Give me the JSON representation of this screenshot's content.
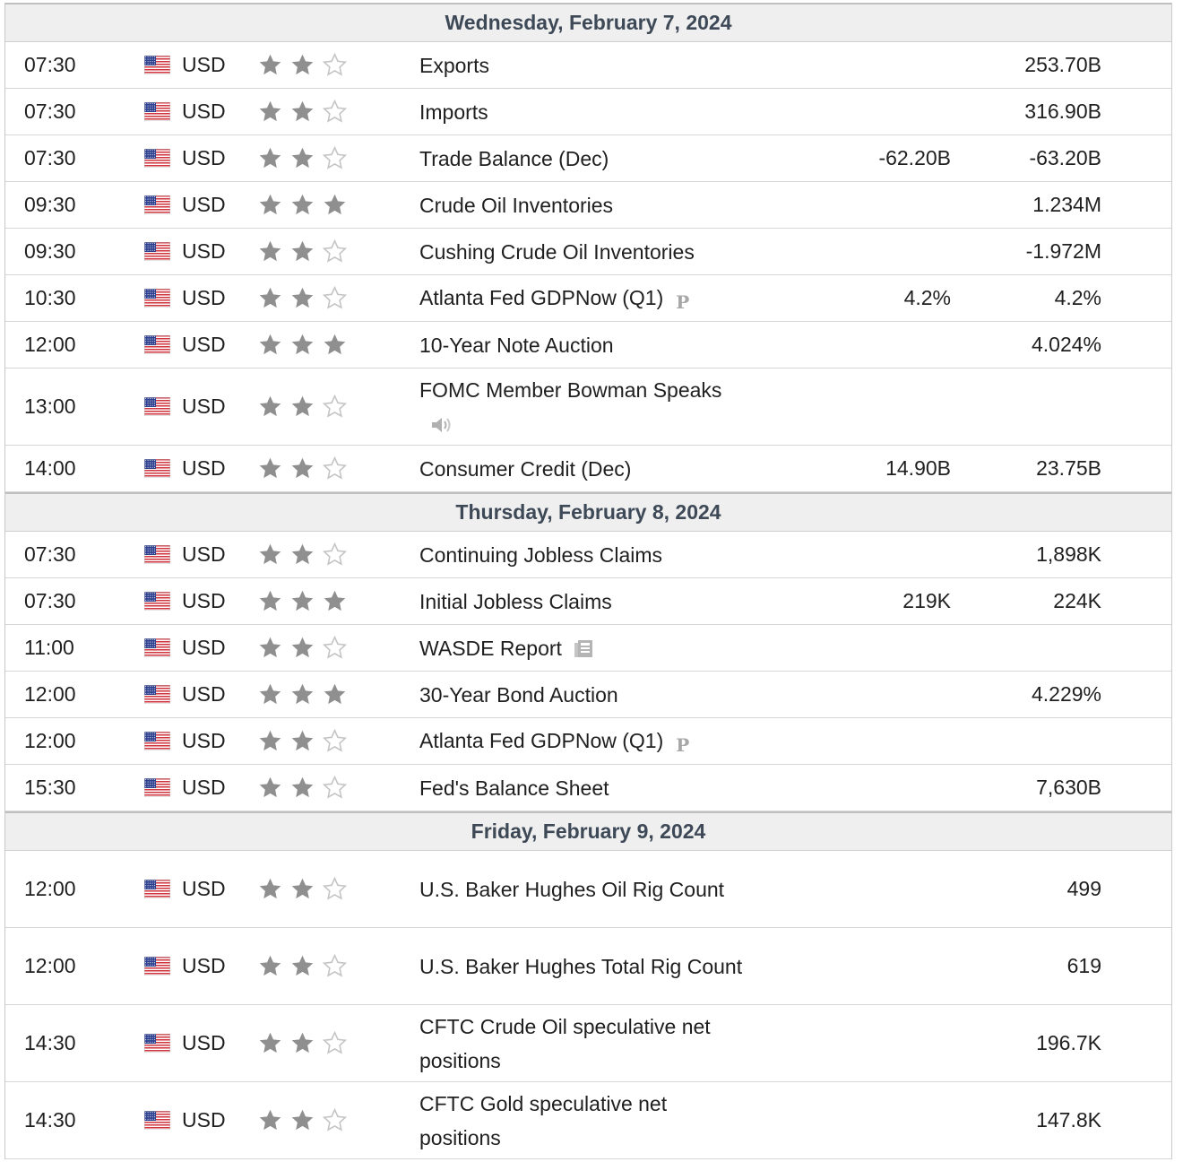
{
  "days": [
    {
      "title": "Wednesday, February 7, 2024",
      "events": [
        {
          "time": "07:30",
          "currency": "USD",
          "stars": 2,
          "name": "Exports",
          "forecast": "",
          "previous": "253.70B"
        },
        {
          "time": "07:30",
          "currency": "USD",
          "stars": 2,
          "name": "Imports",
          "forecast": "",
          "previous": "316.90B"
        },
        {
          "time": "07:30",
          "currency": "USD",
          "stars": 2,
          "name": "Trade Balance (Dec)",
          "forecast": "-62.20B",
          "previous": "-63.20B"
        },
        {
          "time": "09:30",
          "currency": "USD",
          "stars": 3,
          "name": "Crude Oil Inventories",
          "forecast": "",
          "previous": "1.234M"
        },
        {
          "time": "09:30",
          "currency": "USD",
          "stars": 2,
          "name": "Cushing Crude Oil Inventories",
          "forecast": "",
          "previous": "-1.972M"
        },
        {
          "time": "10:30",
          "currency": "USD",
          "stars": 2,
          "name": "Atlanta Fed GDPNow (Q1)",
          "icon": "preliminary-icon",
          "forecast": "4.2%",
          "previous": "4.2%"
        },
        {
          "time": "12:00",
          "currency": "USD",
          "stars": 3,
          "name": "10-Year Note Auction",
          "forecast": "",
          "previous": "4.024%"
        },
        {
          "time": "13:00",
          "currency": "USD",
          "stars": 2,
          "name": "FOMC Member Bowman Speaks",
          "icon": "speaker-icon",
          "forecast": "",
          "previous": "",
          "tall": true
        },
        {
          "time": "14:00",
          "currency": "USD",
          "stars": 2,
          "name": "Consumer Credit (Dec)",
          "forecast": "14.90B",
          "previous": "23.75B"
        }
      ]
    },
    {
      "title": "Thursday, February 8, 2024",
      "events": [
        {
          "time": "07:30",
          "currency": "USD",
          "stars": 2,
          "name": "Continuing Jobless Claims",
          "forecast": "",
          "previous": "1,898K"
        },
        {
          "time": "07:30",
          "currency": "USD",
          "stars": 3,
          "name": "Initial Jobless Claims",
          "forecast": "219K",
          "previous": "224K"
        },
        {
          "time": "11:00",
          "currency": "USD",
          "stars": 2,
          "name": "WASDE Report",
          "icon": "report-icon",
          "forecast": "",
          "previous": ""
        },
        {
          "time": "12:00",
          "currency": "USD",
          "stars": 3,
          "name": "30-Year Bond Auction",
          "forecast": "",
          "previous": "4.229%"
        },
        {
          "time": "12:00",
          "currency": "USD",
          "stars": 2,
          "name": "Atlanta Fed GDPNow (Q1)",
          "icon": "preliminary-icon",
          "forecast": "",
          "previous": ""
        },
        {
          "time": "15:30",
          "currency": "USD",
          "stars": 2,
          "name": "Fed's Balance Sheet",
          "forecast": "",
          "previous": "7,630B"
        }
      ]
    },
    {
      "title": "Friday, February 9, 2024",
      "events": [
        {
          "time": "12:00",
          "currency": "USD",
          "stars": 2,
          "name": "U.S. Baker Hughes Oil Rig Count",
          "forecast": "",
          "previous": "499",
          "tall": true
        },
        {
          "time": "12:00",
          "currency": "USD",
          "stars": 2,
          "name": "U.S. Baker Hughes Total Rig Count",
          "forecast": "",
          "previous": "619",
          "tall": true
        },
        {
          "time": "14:30",
          "currency": "USD",
          "stars": 2,
          "name": "CFTC Crude Oil speculative net positions",
          "forecast": "",
          "previous": "196.7K",
          "tall": true
        },
        {
          "time": "14:30",
          "currency": "USD",
          "stars": 2,
          "name": "CFTC Gold speculative net positions",
          "forecast": "",
          "previous": "147.8K",
          "tall": true
        }
      ]
    }
  ],
  "icons": {
    "flag": "us-flag-icon",
    "star": "star-icon"
  },
  "colors": {
    "header_bg": "#efefef",
    "header_text": "#3e4957",
    "star_filled": "#8f8f8f",
    "star_empty": "#c4c4c4",
    "flag_red": "#d0343f",
    "flag_blue": "#2d3f8f"
  },
  "preliminary_label": "P"
}
